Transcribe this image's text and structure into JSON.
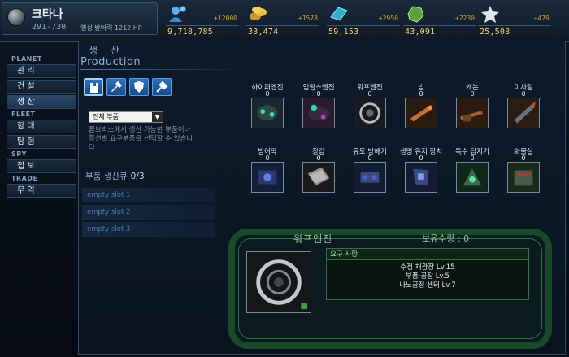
{
  "planet": {
    "name": "크타나",
    "coord": "291-730",
    "defense": "행성 방어력 1212 HP"
  },
  "resources": [
    {
      "icon": "population-icon",
      "amount": "9,718,785",
      "increment": "+12000",
      "color": "#4aa0e0"
    },
    {
      "icon": "gold-coins-icon",
      "amount": "33,474",
      "increment": "+1578",
      "color": "#e0b830"
    },
    {
      "icon": "crystal-icon",
      "amount": "59,153",
      "increment": "+2950",
      "color": "#40c8d8"
    },
    {
      "icon": "mineral-ore-icon",
      "amount": "43,091",
      "increment": "+2230",
      "color": "#78c850"
    },
    {
      "icon": "star-icon",
      "amount": "25,508",
      "increment": "+479",
      "color": "#d8e0e8"
    }
  ],
  "sidebar": {
    "planet_label": "PLANET",
    "fleet_label": "FLEET",
    "spy_label": "SPY",
    "trade_label": "TRADE",
    "items": {
      "manage": "관 리",
      "build": "건 설",
      "produce": "생 산",
      "fleet": "함 대",
      "explore": "탐 험",
      "intel": "첩 보",
      "trade": "무 역"
    }
  },
  "main": {
    "title_kr": "생 산",
    "title_en": "Production",
    "tabs": [
      {
        "icon": "ship-hull-icon"
      },
      {
        "icon": "weapon-icon"
      },
      {
        "icon": "shield-icon"
      },
      {
        "icon": "device-icon"
      }
    ],
    "filter": "전체 부품",
    "description": "콤보박스에서 생산 가능한 부품이나 항선별 요구부품을 선택할 수 있습니다",
    "queue": {
      "label": "부품 생산큐",
      "count": "0/3",
      "slots": [
        "empty slot 1",
        "empty slot 2",
        "empty slot 3"
      ]
    }
  },
  "parts": [
    {
      "name": "하이퍼엔진",
      "qty": "0",
      "icon": "hyper-engine-icon"
    },
    {
      "name": "임펄스엔진",
      "qty": "0",
      "icon": "impulse-engine-icon"
    },
    {
      "name": "워프엔진",
      "qty": "0",
      "icon": "warp-engine-icon"
    },
    {
      "name": "빔",
      "qty": "0",
      "icon": "beam-icon"
    },
    {
      "name": "캐논",
      "qty": "0",
      "icon": "cannon-icon"
    },
    {
      "name": "미사일",
      "qty": "0",
      "icon": "missile-icon"
    },
    {
      "name": "방어막",
      "qty": "0",
      "icon": "shield-generator-icon"
    },
    {
      "name": "장갑",
      "qty": "0",
      "icon": "armor-icon"
    },
    {
      "name": "유도 방해기",
      "qty": "0",
      "icon": "jammer-icon"
    },
    {
      "name": "생명 유지 장치",
      "qty": "0",
      "icon": "life-support-icon"
    },
    {
      "name": "특수 탐지기",
      "qty": "0",
      "icon": "detector-icon"
    },
    {
      "name": "화물실",
      "qty": "0",
      "icon": "cargo-icon"
    }
  ],
  "detail": {
    "name": "워프엔진",
    "owned": "보유수량 : 0",
    "req_title": "요구 사항",
    "requirements": [
      "수정 채광장 Lv.15",
      "부품 공장 Lv.5",
      "나노공정 센터 Lv.7"
    ]
  }
}
